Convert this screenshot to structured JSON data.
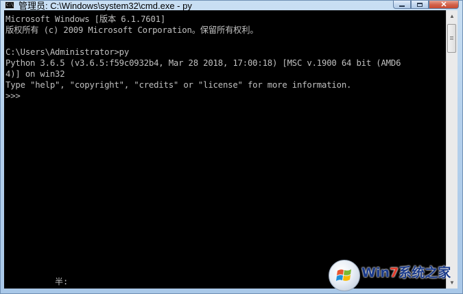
{
  "window": {
    "title": "管理员: C:\\Windows\\system32\\cmd.exe - py",
    "icon": "cmd-app-icon",
    "icon_text": "C:\\"
  },
  "controls": {
    "minimize": "minimize-icon",
    "maximize": "maximize-icon",
    "close": "✕"
  },
  "console": {
    "lines": [
      "Microsoft Windows [版本 6.1.7601]",
      "版权所有 (c) 2009 Microsoft Corporation。保留所有权利。",
      "",
      "C:\\Users\\Administrator>py",
      "Python 3.6.5 (v3.6.5:f59c0932b4, Mar 28 2018, 17:00:18) [MSC v.1900 64 bit (AMD6",
      "4)] on win32",
      "Type \"help\", \"copyright\", \"credits\" or \"license\" for more information.",
      ">>>"
    ],
    "ime_status": "半:"
  },
  "colors": {
    "console_bg": "#000000",
    "console_fg": "#c0c0c0",
    "frame": "#b4d0ec",
    "close_button": "#c74a32"
  },
  "watermark": {
    "part1": "Win",
    "part2": "7",
    "part3": "系统之家"
  }
}
